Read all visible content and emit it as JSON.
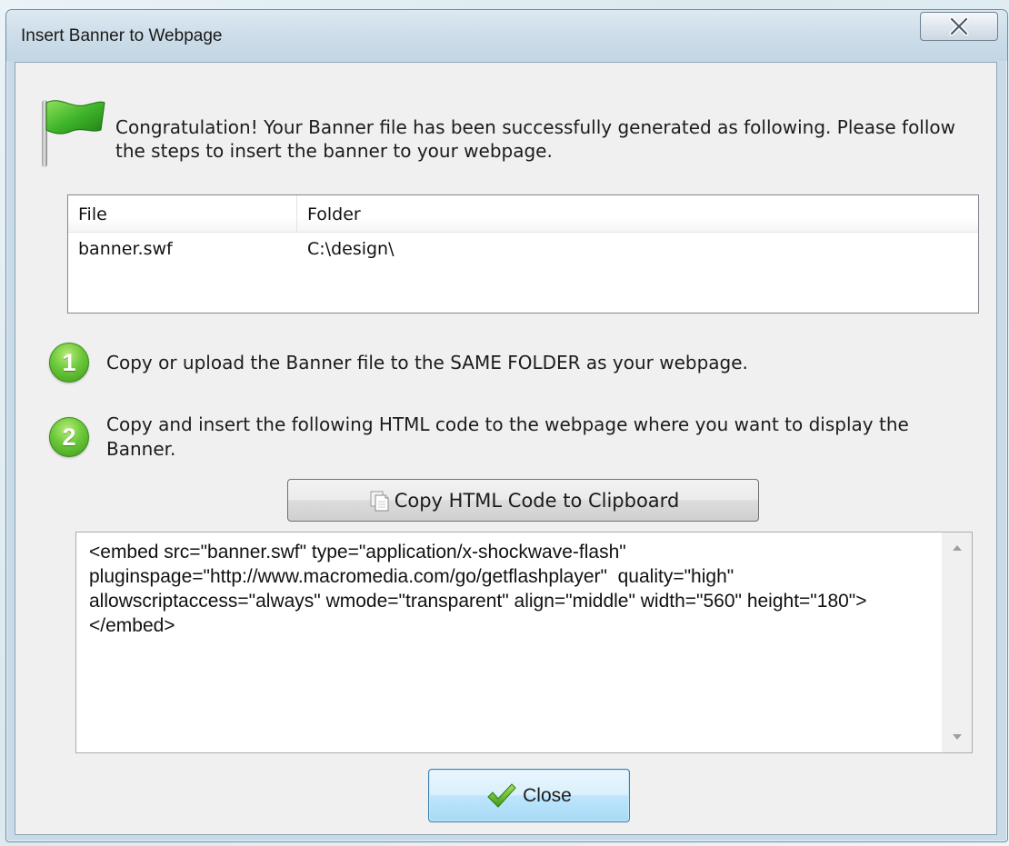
{
  "window": {
    "title": "Insert Banner to Webpage"
  },
  "message": {
    "congrats": "Congratulation! Your Banner file has been successfully generated as following. Please follow the steps to insert the banner to your webpage."
  },
  "file_list": {
    "columns": [
      "File",
      "Folder"
    ],
    "rows": [
      {
        "file": "banner.swf",
        "folder": "C:\\design\\"
      }
    ]
  },
  "steps": [
    {
      "number": "1",
      "text": "Copy or upload the Banner file to the SAME FOLDER as your webpage."
    },
    {
      "number": "2",
      "text": "Copy and insert the following HTML code to the webpage where you want to display the Banner."
    }
  ],
  "copy_button": {
    "label": "Copy HTML Code to Clipboard",
    "icon": "clipboard-icon"
  },
  "html_code": "<embed src=\"banner.swf\" type=\"application/x-shockwave-flash\" pluginspage=\"http://www.macromedia.com/go/getflashplayer\"  quality=\"high\" allowscriptaccess=\"always\" wmode=\"transparent\" align=\"middle\" width=\"560\" height=\"180\"></embed>",
  "close_button": {
    "label": "Close",
    "icon": "checkmark-icon"
  },
  "colors": {
    "accent_green": "#5cbf2a",
    "button_hover_blue": "#3c7fb1"
  }
}
